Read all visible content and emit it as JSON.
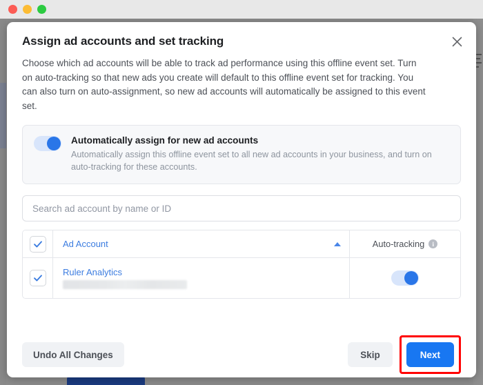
{
  "window": {
    "traffic_lights": [
      "close",
      "minimize",
      "zoom"
    ]
  },
  "modal": {
    "title": "Assign ad accounts and set tracking",
    "close_icon": "close-icon",
    "description": "Choose which ad accounts will be able to track ad performance using this offline event set. Turn on auto-tracking so that new ads you create will default to this offline event set for tracking. You can also turn on auto-assignment, so new ad accounts will automatically be assigned to this event set.",
    "auto_assign": {
      "toggle_state": "on",
      "title": "Automatically assign for new ad accounts",
      "subtitle": "Automatically assign this offline event set to all new ad accounts in your business, and turn on auto-tracking for these accounts."
    },
    "search": {
      "placeholder": "Search ad account by name or ID",
      "value": ""
    },
    "table": {
      "select_all_checked": true,
      "columns": {
        "ad_account": "Ad Account",
        "sort_direction": "ascending",
        "auto_tracking": "Auto-tracking",
        "info_glyph": "i"
      },
      "rows": [
        {
          "checked": true,
          "name": "Ruler Analytics",
          "id_redacted": true,
          "auto_tracking": "on"
        }
      ]
    },
    "footer": {
      "undo_label": "Undo All Changes",
      "skip_label": "Skip",
      "next_label": "Next"
    }
  },
  "annotation": {
    "highlight_color": "#ff0000",
    "highlight_target": "Next"
  },
  "colors": {
    "accent_blue": "#1877f2",
    "toggle_track": "#d8e5fb",
    "toggle_knob": "#2a76e8",
    "link_blue": "#3b7ce0"
  }
}
